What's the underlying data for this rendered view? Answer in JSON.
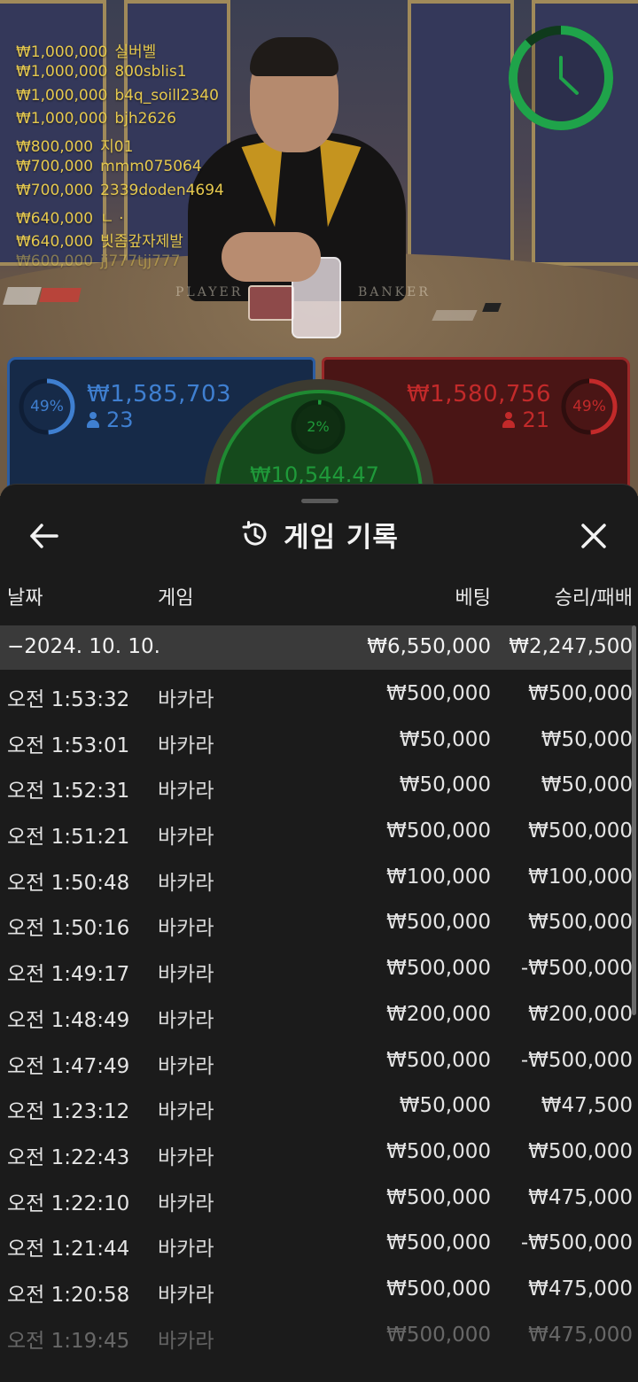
{
  "stream": {
    "table_labels": {
      "player": "PLAYER",
      "banker": "BANKER"
    },
    "chat": [
      {
        "amount": "₩1,000,000",
        "user": "실버벨"
      },
      {
        "amount": "₩1,000,000",
        "user": "800sblis1"
      },
      {
        "amount": "₩1,000,000",
        "user": "b4q_soill2340"
      },
      {
        "amount": "₩1,000,000",
        "user": "bjh2626"
      },
      {
        "amount": "₩800,000",
        "user": "지01"
      },
      {
        "amount": "₩700,000",
        "user": "mmm075064"
      },
      {
        "amount": "₩700,000",
        "user": "2339doden4694"
      },
      {
        "amount": "₩640,000",
        "user": "ㄴ ·"
      },
      {
        "amount": "₩640,000",
        "user": "빗좀갚자제발"
      },
      {
        "amount": "₩600,000",
        "user": "jj777tjj777"
      }
    ],
    "timer": {
      "fraction_remaining": 0.88,
      "color": "#1fa34a"
    }
  },
  "betting": {
    "player": {
      "percent_label": "49%",
      "percent": 49,
      "amount": "₩1,585,703",
      "players": "23",
      "color": "#3f7fd0"
    },
    "banker": {
      "percent_label": "49%",
      "percent": 49,
      "amount": "₩1,580,756",
      "players": "21",
      "color": "#c22a2a"
    },
    "tie": {
      "percent_label": "2%",
      "percent": 2,
      "amount": "₩10,544.47",
      "color": "#1f9a3a"
    }
  },
  "history": {
    "title": "게임 기록",
    "icons": {
      "back": "arrow-left-icon",
      "history": "history-icon",
      "close": "close-icon"
    },
    "columns": {
      "date": "날짜",
      "game": "게임",
      "bet": "베팅",
      "result": "승리/패배"
    },
    "summary": {
      "date": "−2024. 10. 10.",
      "bet": "₩6,550,000",
      "result": "₩2,247,500"
    },
    "rows": [
      {
        "time": "오전 1:53:32",
        "game": "바카라",
        "bet": "₩500,000",
        "result": "₩500,000"
      },
      {
        "time": "오전 1:53:01",
        "game": "바카라",
        "bet": "₩50,000",
        "result": "₩50,000"
      },
      {
        "time": "오전 1:52:31",
        "game": "바카라",
        "bet": "₩50,000",
        "result": "₩50,000"
      },
      {
        "time": "오전 1:51:21",
        "game": "바카라",
        "bet": "₩500,000",
        "result": "₩500,000"
      },
      {
        "time": "오전 1:50:48",
        "game": "바카라",
        "bet": "₩100,000",
        "result": "₩100,000"
      },
      {
        "time": "오전 1:50:16",
        "game": "바카라",
        "bet": "₩500,000",
        "result": "₩500,000"
      },
      {
        "time": "오전 1:49:17",
        "game": "바카라",
        "bet": "₩500,000",
        "result": "-₩500,000"
      },
      {
        "time": "오전 1:48:49",
        "game": "바카라",
        "bet": "₩200,000",
        "result": "₩200,000"
      },
      {
        "time": "오전 1:47:49",
        "game": "바카라",
        "bet": "₩500,000",
        "result": "-₩500,000"
      },
      {
        "time": "오전 1:23:12",
        "game": "바카라",
        "bet": "₩50,000",
        "result": "₩47,500"
      },
      {
        "time": "오전 1:22:43",
        "game": "바카라",
        "bet": "₩500,000",
        "result": "₩500,000"
      },
      {
        "time": "오전 1:22:10",
        "game": "바카라",
        "bet": "₩500,000",
        "result": "₩475,000"
      },
      {
        "time": "오전 1:21:44",
        "game": "바카라",
        "bet": "₩500,000",
        "result": "-₩500,000"
      },
      {
        "time": "오전 1:20:58",
        "game": "바카라",
        "bet": "₩500,000",
        "result": "₩475,000"
      },
      {
        "time": "오전 1:19:45",
        "game": "바카라",
        "bet": "₩500,000",
        "result": "₩475,000"
      }
    ]
  }
}
